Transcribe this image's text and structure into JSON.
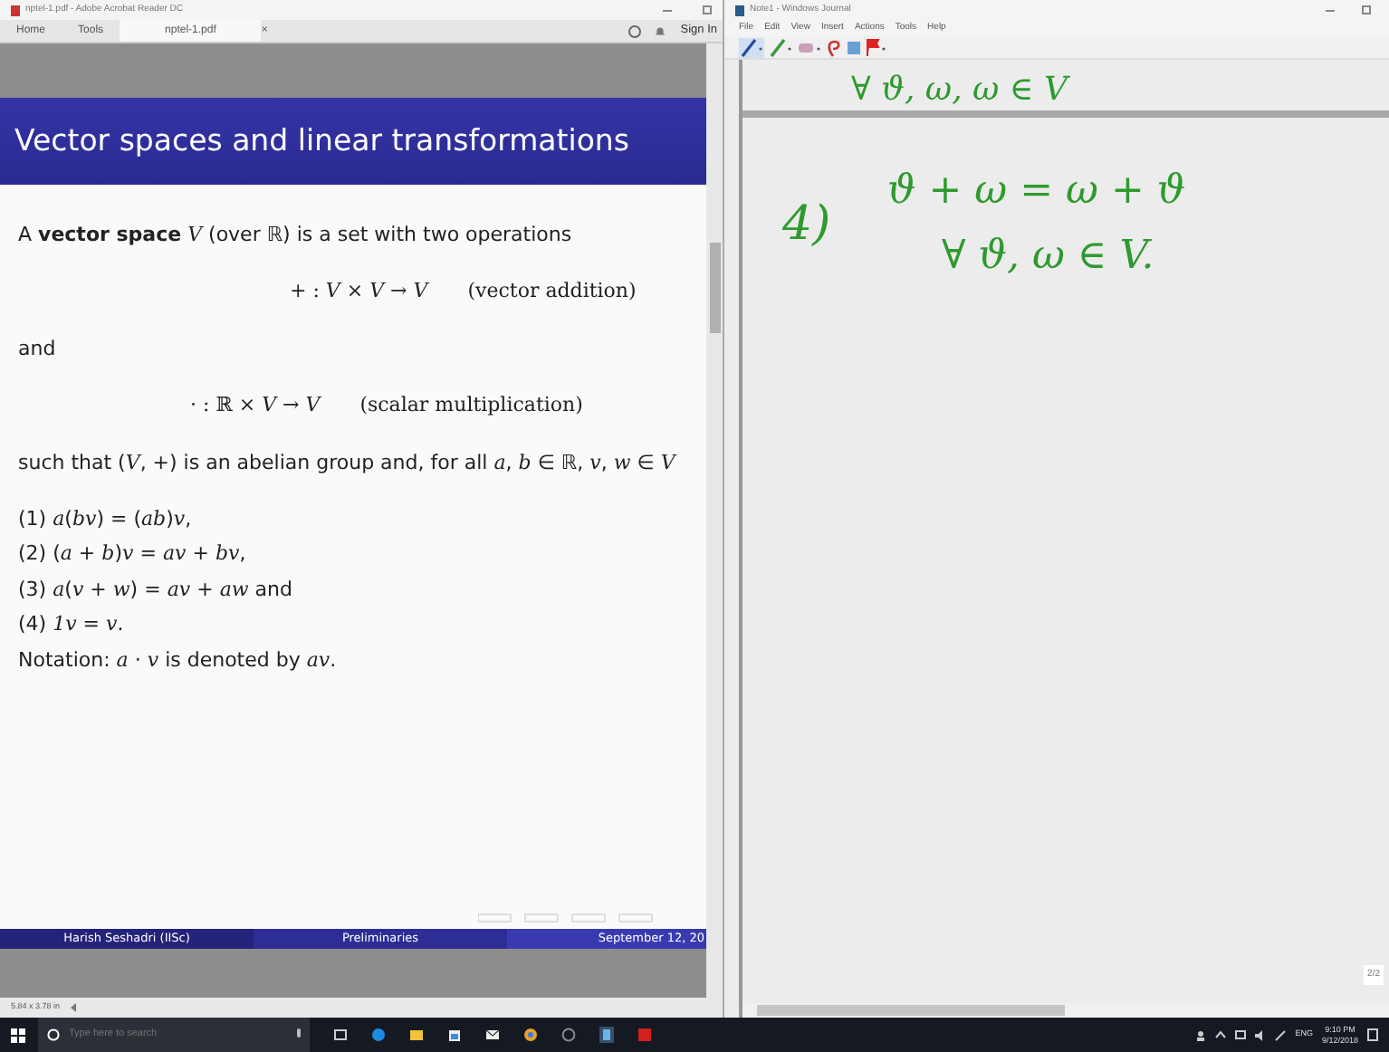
{
  "reader": {
    "title": "nptel-1.pdf - Adobe Acrobat Reader DC",
    "tabs": [
      {
        "label": "Home",
        "selected": false
      },
      {
        "label": "Tools",
        "selected": false
      },
      {
        "label": "nptel-1.pdf",
        "selected": true
      }
    ],
    "tab_close": "×",
    "sign_in": "Sign In",
    "slide": {
      "title": "Vector spaces and linear transformations",
      "lines": [
        {
          "kind": "text",
          "text": "A **vector space** *V* (over ℝ) is a set with two operations"
        },
        {
          "kind": "formula",
          "text": "+ : *V* × *V* → *V*",
          "note": "(vector addition)"
        },
        {
          "kind": "text",
          "text": "and"
        },
        {
          "kind": "formula",
          "text": "· : ℝ × *V* → *V*",
          "note": "(scalar multiplication)"
        },
        {
          "kind": "text",
          "text": "such that (*V*, +) is an abelian group and, for all *a*, *b* ∈ ℝ, *v*, *w* ∈ *V*"
        },
        {
          "kind": "item",
          "text": "(1) *a*(*bv*) = (*ab*)*v*,"
        },
        {
          "kind": "item",
          "text": "(2) (*a* + *b*)*v* = *av* + *bv*,"
        },
        {
          "kind": "item",
          "text": "(3) *a*(*v* + *w*) = *av* + *aw* and"
        },
        {
          "kind": "item",
          "text": "(4) *1v* = *v*."
        },
        {
          "kind": "text",
          "text": "Notation: *a* · *v* is denoted by *av*."
        }
      ],
      "footer": [
        "Harish Seshadri (IISc)",
        "Preliminaries",
        "September 12, 20"
      ]
    },
    "status": "5.84 x 3.78 in"
  },
  "journal": {
    "title": "Note1 - Windows Journal",
    "menu": [
      "File",
      "Edit",
      "View",
      "Insert",
      "Actions",
      "Tools",
      "Help"
    ],
    "ink_top": "∀ ϑ, ω, ω ∈ V",
    "ink": [
      "4)",
      "ϑ + ω = ω + ϑ",
      "∀ ϑ, ω ∈ V."
    ],
    "page_number": "2/2"
  },
  "taskbar": {
    "search_placeholder": "Type here to search",
    "apps": [
      {
        "kind": "taskview"
      },
      {
        "kind": "browser"
      },
      {
        "kind": "folder"
      },
      {
        "kind": "store"
      },
      {
        "kind": "mail"
      },
      {
        "kind": "chrome"
      },
      {
        "kind": "circle"
      },
      {
        "kind": "journal"
      },
      {
        "kind": "pdf"
      }
    ],
    "language": "ENG",
    "time": "9:10 PM",
    "date": "9/12/2018"
  }
}
